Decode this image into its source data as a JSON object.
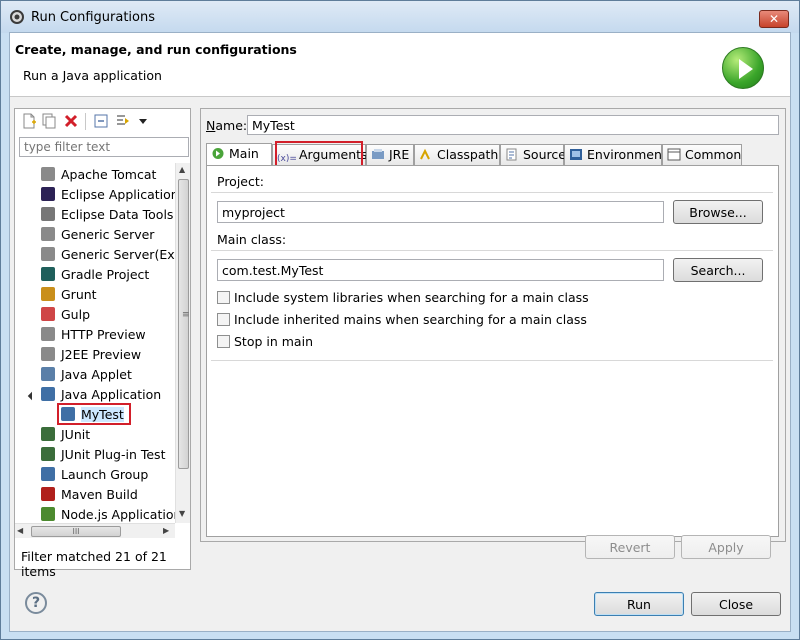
{
  "window": {
    "title": "Run Configurations",
    "close_glyph": "✕"
  },
  "header": {
    "title": "Create, manage, and run configurations",
    "subtitle": "Run a Java application",
    "badge_icon": "run-icon"
  },
  "left": {
    "toolbar_icons": [
      "new-config-icon",
      "duplicate-icon",
      "delete-icon",
      "collapse-all-icon",
      "filter-icon",
      "dropdown-arrow-icon"
    ],
    "filter_placeholder": "type filter text",
    "tree": [
      {
        "label": "Apache Tomcat",
        "icon": "tomcat-icon",
        "color": "#8a8a8a"
      },
      {
        "label": "Eclipse Application",
        "icon": "eclipse-icon",
        "color": "#2c2255"
      },
      {
        "label": "Eclipse Data Tools",
        "icon": "database-icon",
        "color": "#777777"
      },
      {
        "label": "Generic Server",
        "icon": "server-icon",
        "color": "#8a8a8a"
      },
      {
        "label": "Generic Server(Exte",
        "icon": "server-icon",
        "color": "#8a8a8a"
      },
      {
        "label": "Gradle Project",
        "icon": "gradle-icon",
        "color": "#1f5f5b"
      },
      {
        "label": "Grunt",
        "icon": "grunt-icon",
        "color": "#c98f1b"
      },
      {
        "label": "Gulp",
        "icon": "gulp-icon",
        "color": "#cf4647"
      },
      {
        "label": "HTTP Preview",
        "icon": "server-icon",
        "color": "#8a8a8a"
      },
      {
        "label": "J2EE Preview",
        "icon": "server-icon",
        "color": "#8a8a8a"
      },
      {
        "label": "Java Applet",
        "icon": "applet-icon",
        "color": "#5a7fa8"
      },
      {
        "label": "Java Application",
        "icon": "java-app-icon",
        "color": "#3f6fa5"
      },
      {
        "label": "MyTest",
        "icon": "java-app-icon",
        "color": "#3f6fa5"
      },
      {
        "label": "JUnit",
        "icon": "junit-icon",
        "color": "#3b6d3b"
      },
      {
        "label": "JUnit Plug-in Test",
        "icon": "junit-plugin-icon",
        "color": "#3b6d3b"
      },
      {
        "label": "Launch Group",
        "icon": "launch-group-icon",
        "color": "#3f6fa5"
      },
      {
        "label": "Maven Build",
        "icon": "maven-icon",
        "color": "#b0201c"
      },
      {
        "label": "Node.js Application",
        "icon": "nodejs-icon",
        "color": "#4c8a2f"
      }
    ],
    "status": "Filter matched 21 of 21 items",
    "hscroll_grip": "III",
    "vscroll_grip": "≡",
    "scroll_up": "▲",
    "scroll_down": "▼"
  },
  "right": {
    "name_label_pre": "",
    "name_label_ul": "N",
    "name_label_post": "ame:",
    "name_value": "MyTest",
    "tabs": [
      {
        "label": "Main",
        "icon": "main-tab-icon"
      },
      {
        "label": "Arguments",
        "icon": "arguments-icon"
      },
      {
        "label": "JRE",
        "icon": "jre-icon"
      },
      {
        "label": "Classpath",
        "icon": "classpath-icon"
      },
      {
        "label": "Source",
        "icon": "source-icon"
      },
      {
        "label": "Environment",
        "icon": "environment-icon"
      },
      {
        "label": "Common",
        "icon": "common-icon"
      }
    ],
    "project_label": "Project:",
    "project_value": "myproject",
    "browse_label": "Browse...",
    "mainclass_label": "Main class:",
    "mainclass_value": "com.test.MyTest",
    "search_label": "Search...",
    "checkboxes": [
      "Include system libraries when searching for a main class",
      "Include inherited mains when searching for a main class",
      "Stop in main"
    ],
    "revert_label": "Revert",
    "apply_label": "Apply"
  },
  "footer": {
    "help_glyph": "?",
    "run_label": "Run",
    "close_label": "Close"
  }
}
